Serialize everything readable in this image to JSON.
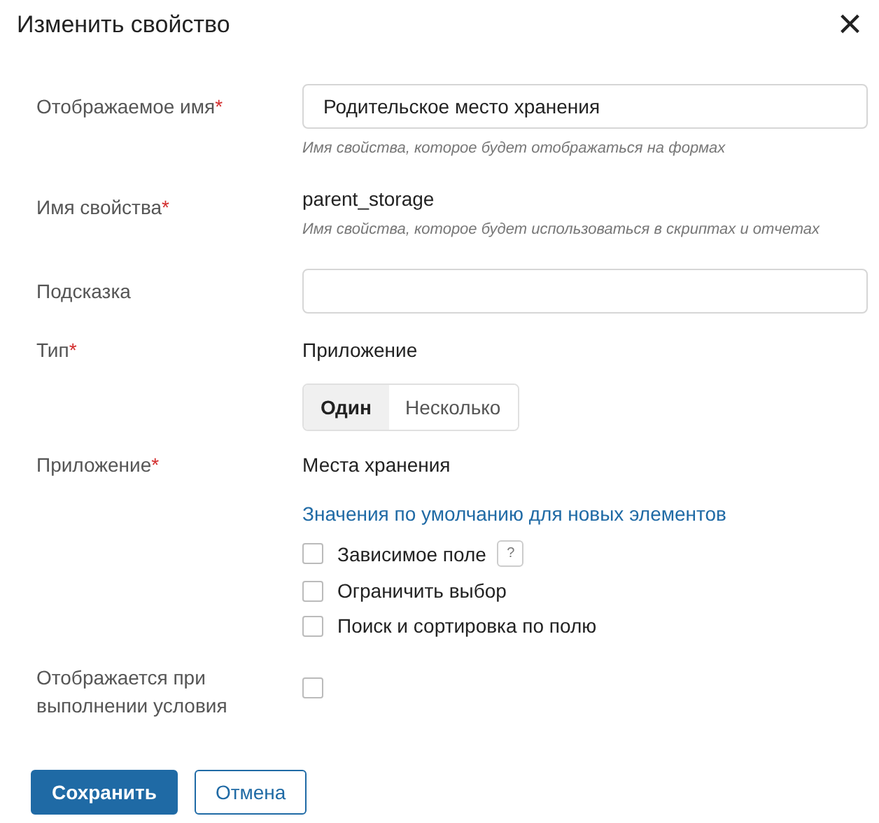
{
  "window": {
    "title": "Изменить свойство",
    "close": "×"
  },
  "fields": [
    {
      "kind": "input",
      "label": "Отображаемое имя",
      "required_mark": "*",
      "value": "Родительское место хранения",
      "help": "Имя свойства, которое будет отображаться на формах"
    },
    {
      "kind": "text",
      "label": "Имя свойства",
      "required_mark": "*",
      "value": "parent_storage",
      "help": "Имя свойства, которое будет использоваться в скриптах и отчетах"
    },
    {
      "kind": "input",
      "label": "Подсказка"
    },
    {
      "kind": "type",
      "label": "Тип",
      "required_mark": "*",
      "value": "Приложение",
      "segments": [
        {
          "label": "Один",
          "selected": true
        },
        {
          "label": "Несколько",
          "selected": false
        }
      ]
    },
    {
      "kind": "app",
      "label": "Приложение",
      "required_mark": "*",
      "value": "Места хранения",
      "link": "Значения по умолчанию для новых элементов",
      "options": [
        {
          "label": "Зависимое поле",
          "checked": false,
          "help_icon": "?"
        },
        {
          "label": "Ограничить выбор",
          "checked": false
        },
        {
          "label": "Поиск и сортировка по полю",
          "checked": false
        }
      ]
    },
    {
      "kind": "check",
      "label": "Отображается при выполнении условия",
      "checked": false
    }
  ],
  "buttons": [
    {
      "label": "Сохранить",
      "primary": true
    },
    {
      "label": "Отмена",
      "primary": false
    }
  ]
}
